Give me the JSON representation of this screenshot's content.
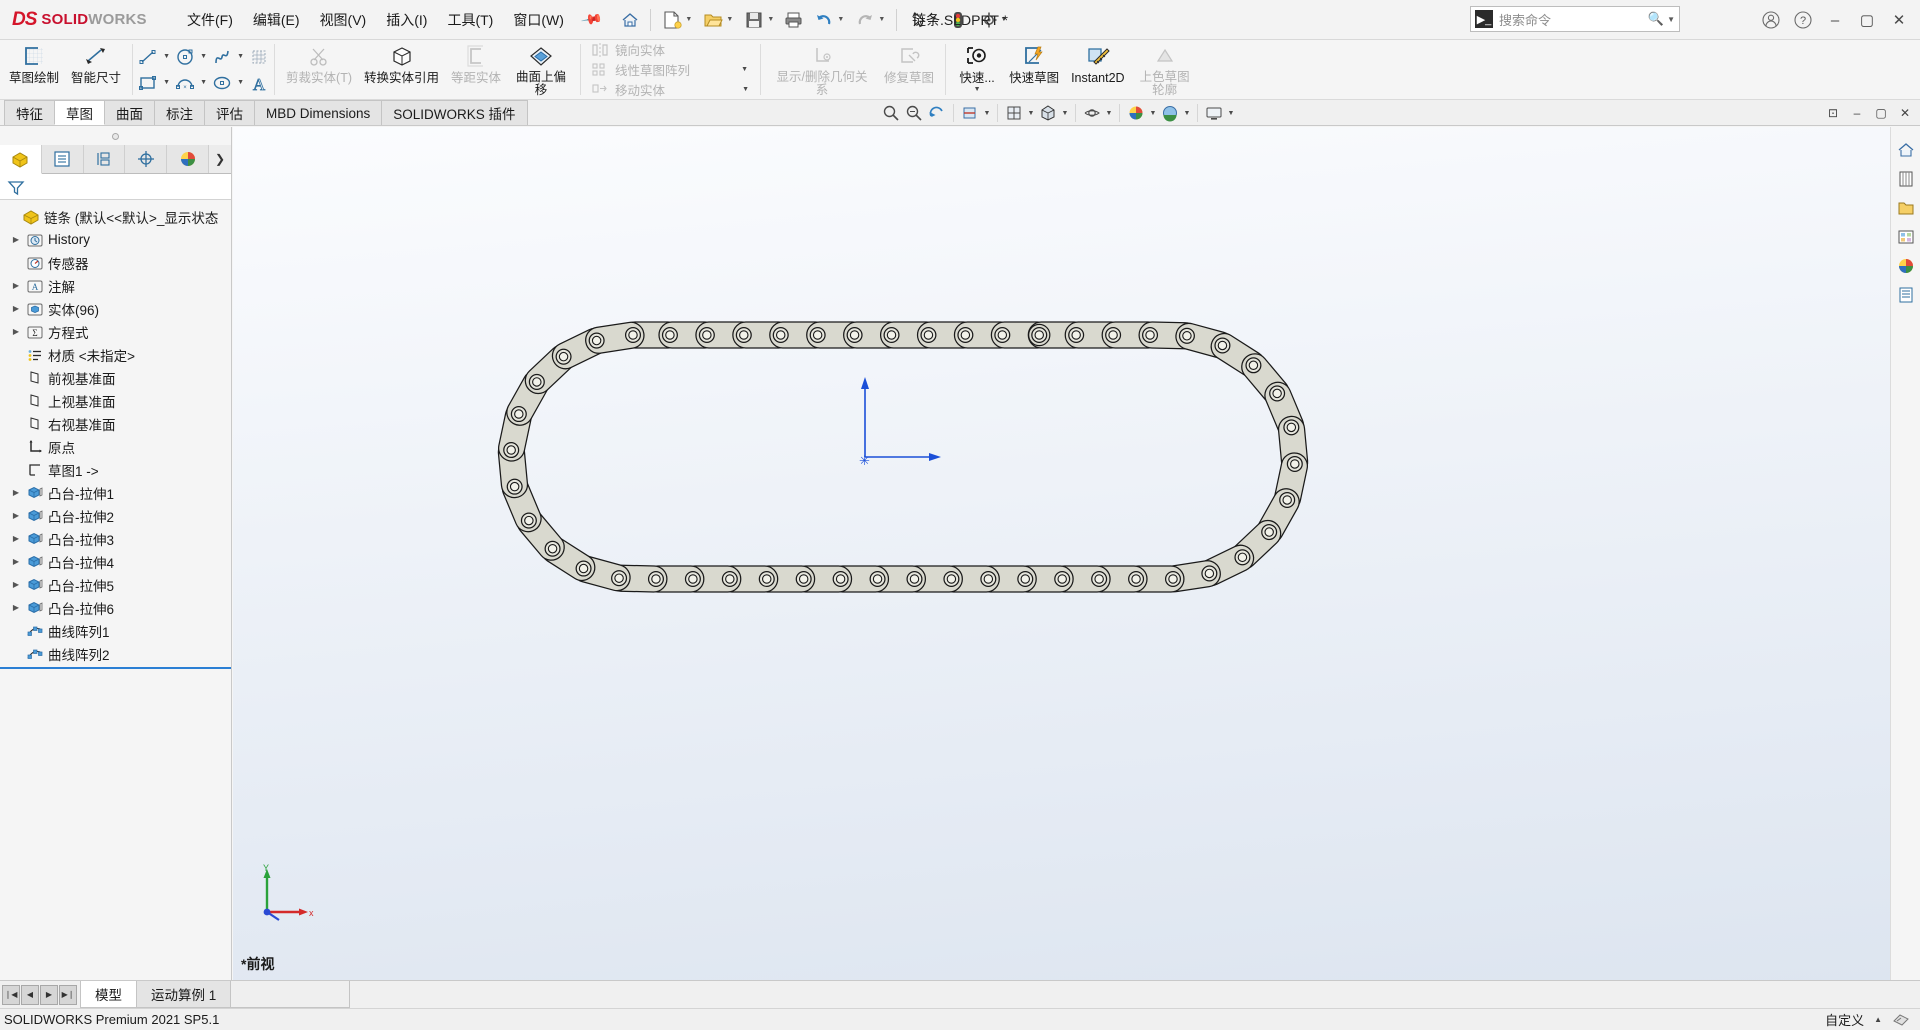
{
  "titlebar": {
    "brand_ds": "DS",
    "brand_solid": "SOLID",
    "brand_works": "WORKS",
    "menus": [
      "文件(F)",
      "编辑(E)",
      "视图(V)",
      "插入(I)",
      "工具(T)",
      "窗口(W)"
    ],
    "pin": "pin-icon",
    "doc_title": "链条.SLDPRT *",
    "search_placeholder": "搜索命令",
    "qat": [
      {
        "name": "home-button",
        "glyph": "⌂"
      },
      {
        "name": "new-document-button",
        "glyph": "doc"
      },
      {
        "name": "open-document-button",
        "glyph": "folder"
      },
      {
        "name": "save-button",
        "glyph": "save"
      },
      {
        "name": "print-button",
        "glyph": "print"
      },
      {
        "name": "undo-button",
        "glyph": "undo"
      },
      {
        "name": "redo-button",
        "glyph": "redo"
      },
      {
        "name": "select-button",
        "glyph": "cursor"
      },
      {
        "name": "rebuild-button",
        "glyph": "traffic"
      },
      {
        "name": "options-button",
        "glyph": "gear"
      }
    ],
    "window_controls": [
      "account-icon",
      "help-icon",
      "minimize",
      "maximize",
      "close"
    ]
  },
  "ribbon": {
    "groups": [
      {
        "name": "sketch-group",
        "big": [
          {
            "label": "草图绘制",
            "icon": "sketch-icon",
            "disabled": false
          },
          {
            "label": "智能尺寸",
            "icon": "smart-dimension-icon",
            "disabled": false
          }
        ]
      },
      {
        "name": "entities-group",
        "rows": [
          [
            "line-icon",
            "circle-icon",
            "spline-icon",
            "grid-icon"
          ],
          [
            "rectangle-icon",
            "arc-icon",
            "ellipse-icon",
            "text-icon"
          ]
        ]
      },
      {
        "name": "tools-group",
        "big": [
          {
            "label": "剪裁实体(T)",
            "icon": "trim-entities-icon",
            "disabled": true
          },
          {
            "label": "转换实体引用",
            "icon": "convert-entities-icon",
            "disabled": false
          },
          {
            "label": "等距实体",
            "icon": "offset-entities-icon",
            "disabled": true
          },
          {
            "label": "曲面上偏移",
            "icon": "offset-on-surface-icon",
            "disabled": false
          }
        ]
      },
      {
        "name": "pattern-group",
        "text_items": [
          {
            "label": "镜向实体",
            "icon": "mirror-entities-icon"
          },
          {
            "label": "线性草图阵列",
            "icon": "linear-sketch-pattern-icon"
          },
          {
            "label": "移动实体",
            "icon": "move-entities-icon"
          }
        ]
      },
      {
        "name": "relations-group",
        "big": [
          {
            "label": "显示/删除几何关系",
            "icon": "display-delete-relations-icon",
            "disabled": true
          },
          {
            "label": "修复草图",
            "icon": "repair-sketch-icon",
            "disabled": true
          }
        ]
      },
      {
        "name": "quick-group",
        "big": [
          {
            "label": "快速...",
            "icon": "quick-snaps-icon",
            "disabled": false
          },
          {
            "label": "快速草图",
            "icon": "rapid-sketch-icon",
            "disabled": false
          },
          {
            "label": "Instant2D",
            "icon": "instant2d-icon",
            "disabled": false
          },
          {
            "label": "上色草图轮廓",
            "icon": "shaded-sketch-contours-icon",
            "disabled": true
          }
        ]
      }
    ]
  },
  "tabs": {
    "items": [
      "特征",
      "草图",
      "曲面",
      "标注",
      "评估",
      "MBD Dimensions",
      "SOLIDWORKS 插件"
    ],
    "active_index": 1
  },
  "view_toolbar": [
    {
      "name": "zoom-to-fit-icon"
    },
    {
      "name": "zoom-to-area-icon"
    },
    {
      "name": "previous-view-icon"
    },
    {
      "name": "section-view-icon"
    },
    {
      "name": "view-orientation-icon"
    },
    {
      "name": "display-style-icon"
    },
    {
      "name": "hide-show-items-icon"
    },
    {
      "name": "edit-appearance-icon"
    },
    {
      "name": "apply-scene-icon"
    },
    {
      "name": "view-settings-icon"
    }
  ],
  "window_buttons": [
    "restore-window-icon",
    "minimize-window-icon",
    "maximize-window-icon",
    "close-window-icon"
  ],
  "left_panel": {
    "tabs": [
      {
        "name": "feature-manager-tab",
        "icon": "feature-tree-icon",
        "active": true
      },
      {
        "name": "property-manager-tab",
        "icon": "property-icon",
        "active": false
      },
      {
        "name": "configuration-manager-tab",
        "icon": "configuration-icon",
        "active": false
      },
      {
        "name": "dimxpert-manager-tab",
        "icon": "dimxpert-icon",
        "active": false
      },
      {
        "name": "display-manager-tab",
        "icon": "display-manager-icon",
        "active": false
      }
    ],
    "filter_placeholder": "",
    "tree": [
      {
        "label": "链条  (默认<<默认>_显示状态",
        "icon": "part-icon",
        "arrow": false,
        "indent": 0,
        "root": true
      },
      {
        "label": "History",
        "icon": "history-icon",
        "arrow": true,
        "indent": 1
      },
      {
        "label": "传感器",
        "icon": "sensors-icon",
        "arrow": false,
        "indent": 1
      },
      {
        "label": "注解",
        "icon": "annotations-icon",
        "arrow": true,
        "indent": 1
      },
      {
        "label": "实体(96)",
        "icon": "solid-bodies-icon",
        "arrow": true,
        "indent": 1
      },
      {
        "label": "方程式",
        "icon": "equations-icon",
        "arrow": true,
        "indent": 1
      },
      {
        "label": "材质 <未指定>",
        "icon": "material-icon",
        "arrow": false,
        "indent": 1
      },
      {
        "label": "前视基准面",
        "icon": "plane-icon",
        "arrow": false,
        "indent": 1
      },
      {
        "label": "上视基准面",
        "icon": "plane-icon",
        "arrow": false,
        "indent": 1
      },
      {
        "label": "右视基准面",
        "icon": "plane-icon",
        "arrow": false,
        "indent": 1
      },
      {
        "label": "原点",
        "icon": "origin-icon",
        "arrow": false,
        "indent": 1
      },
      {
        "label": "草图1 ->",
        "icon": "sketch-feature-icon",
        "arrow": false,
        "indent": 1
      },
      {
        "label": "凸台-拉伸1",
        "icon": "boss-extrude-icon",
        "arrow": true,
        "indent": 1
      },
      {
        "label": "凸台-拉伸2",
        "icon": "boss-extrude-icon",
        "arrow": true,
        "indent": 1
      },
      {
        "label": "凸台-拉伸3",
        "icon": "boss-extrude-icon",
        "arrow": true,
        "indent": 1
      },
      {
        "label": "凸台-拉伸4",
        "icon": "boss-extrude-icon",
        "arrow": true,
        "indent": 1
      },
      {
        "label": "凸台-拉伸5",
        "icon": "boss-extrude-icon",
        "arrow": true,
        "indent": 1
      },
      {
        "label": "凸台-拉伸6",
        "icon": "boss-extrude-icon",
        "arrow": true,
        "indent": 1
      },
      {
        "label": "曲线阵列1",
        "icon": "curve-pattern-icon",
        "arrow": false,
        "indent": 1
      },
      {
        "label": "曲线阵列2",
        "icon": "curve-pattern-icon",
        "arrow": false,
        "indent": 1
      }
    ]
  },
  "graphics": {
    "view_label": "*前视",
    "triad": {
      "x": "x",
      "y": "Y"
    },
    "model_name": "roller-chain-loop"
  },
  "bottom": {
    "tabs": [
      "模型",
      "运动算例 1"
    ],
    "active_index": 0,
    "status_left": "SOLIDWORKS Premium 2021 SP5.1",
    "status_right_label": "自定义"
  },
  "colors": {
    "accent": "#2f7fc1",
    "brand_red": "#d4152a",
    "selection_blue": "#2b7fd4",
    "part_fill": "#d8d8ce",
    "bg_gradient_top": "#fbfcfe",
    "bg_gradient_bottom": "#dde5f0"
  }
}
